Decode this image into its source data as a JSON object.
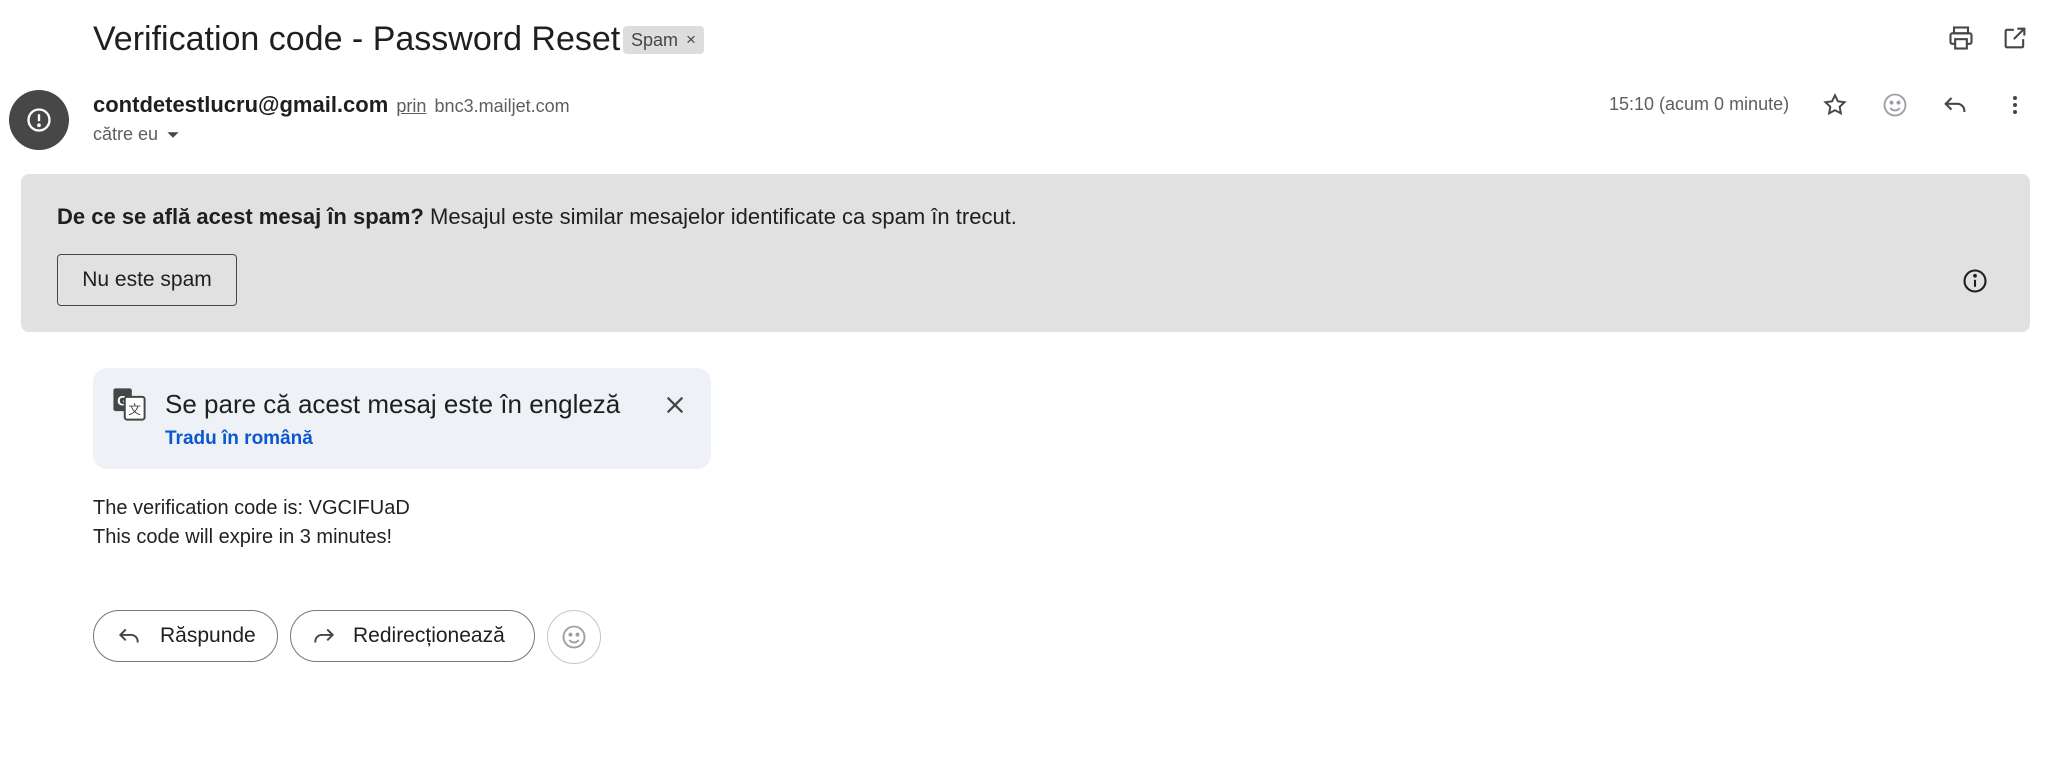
{
  "email": {
    "subject": "Verification code - Password Reset",
    "label_chip": "Spam",
    "label_close": "×",
    "sender_email": "contdetestlucru@gmail.com",
    "via_label": "prin",
    "via_domain": "bnc3.mailjet.com",
    "recipient_label": "către eu",
    "timestamp": "15:10 (acum 0 minute)"
  },
  "toolbar": {
    "print_icon": "print-icon",
    "open_new_window_icon": "open-in-new-window-icon",
    "star_icon": "star-icon",
    "emoji_icon": "emoji-reaction-icon",
    "reply_icon": "reply-icon",
    "more_icon": "more-vert-icon"
  },
  "spam_banner": {
    "question": "De ce se află acest mesaj în spam?",
    "explanation": "Mesajul este similar mesajelor identificate ca spam în trecut.",
    "not_spam_button": "Nu este spam"
  },
  "translate": {
    "title": "Se pare că acest mesaj este în engleză",
    "link": "Tradu în română"
  },
  "body": {
    "line1": "The verification code is: VGCIFUaD",
    "line2": "This code will expire in 3 minutes!"
  },
  "actions": {
    "reply": "Răspunde",
    "forward": "Redirecționează"
  },
  "colors": {
    "banner_bg": "#e1e1e1",
    "avatar_bg": "#474747",
    "link": "#0b57d0",
    "translate_bg": "#eef2f7"
  }
}
